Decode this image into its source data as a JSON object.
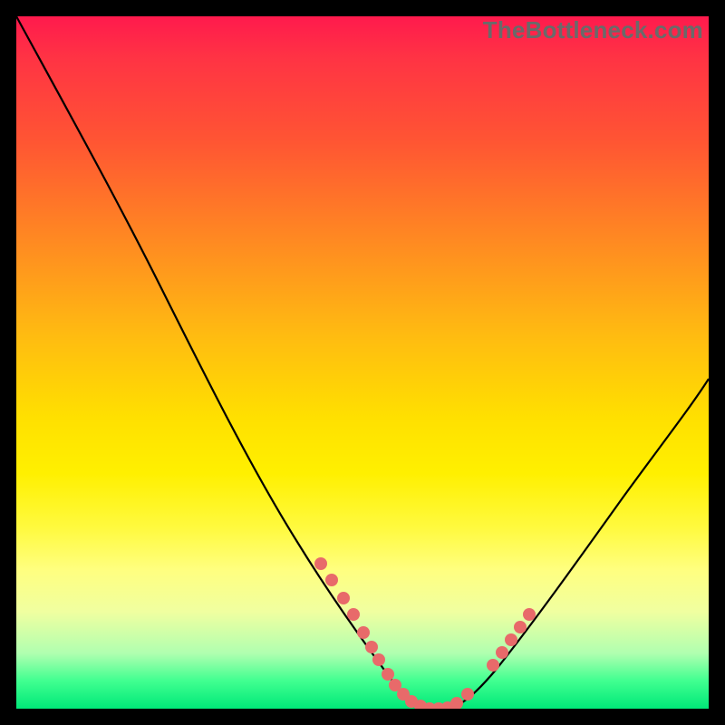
{
  "watermark": "TheBottleneck.com",
  "chart_data": {
    "type": "line",
    "title": "",
    "xlabel": "",
    "ylabel": "",
    "xlim": [
      0,
      100
    ],
    "ylim": [
      0,
      100
    ],
    "series": [
      {
        "name": "main-curve",
        "x": [
          0,
          5,
          10,
          15,
          20,
          25,
          30,
          35,
          40,
          45,
          50,
          53,
          56,
          59,
          62,
          65,
          70,
          75,
          80,
          85,
          90,
          95,
          100
        ],
        "y": [
          100,
          93,
          85,
          76,
          67,
          57,
          47,
          37,
          28,
          20,
          12,
          7,
          3,
          1,
          0,
          1,
          5,
          12,
          20,
          29,
          38,
          47,
          55
        ]
      },
      {
        "name": "highlight-dots-left",
        "x": [
          44,
          46,
          48,
          49,
          50,
          52,
          53,
          54,
          56,
          57,
          59,
          60,
          62
        ],
        "y": [
          21,
          18,
          15,
          13,
          11,
          8,
          7,
          5,
          3,
          2,
          1,
          0.5,
          0
        ]
      },
      {
        "name": "highlight-dots-right",
        "x": [
          63,
          64,
          66,
          67,
          70,
          71,
          72,
          74
        ],
        "y": [
          0,
          0.5,
          2,
          3,
          6,
          8,
          10,
          13
        ]
      }
    ],
    "background_gradient": {
      "top": "#ff1a4d",
      "middle": "#ffe000",
      "bottom": "#00e878"
    },
    "colors": {
      "curve": "#000000",
      "dots": "#e86a6a",
      "frame": "#000000"
    }
  }
}
